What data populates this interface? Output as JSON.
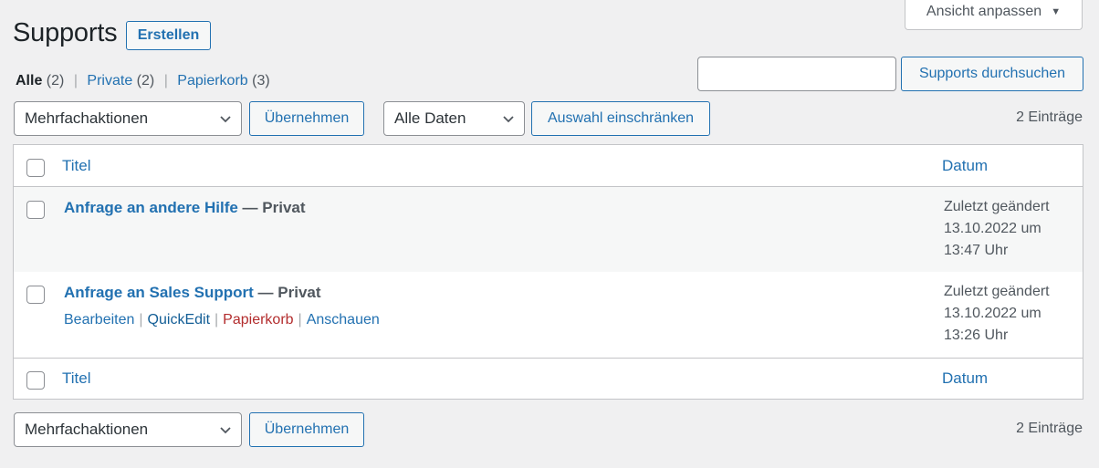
{
  "screen_options": {
    "label": "Ansicht anpassen",
    "arrow_icon": "triangle-down-icon"
  },
  "page": {
    "title": "Supports",
    "add_new_label": "Erstellen"
  },
  "views": [
    {
      "label": "Alle",
      "count": "(2)",
      "current": true
    },
    {
      "label": "Private",
      "count": "(2)",
      "current": false
    },
    {
      "label": "Papierkorb",
      "count": "(3)",
      "current": false
    }
  ],
  "views_sep": "|",
  "search": {
    "value": "",
    "placeholder": "",
    "button_label": "Supports durchsuchen"
  },
  "top_nav": {
    "bulk_action_selected": "Mehrfachaktionen",
    "apply_label": "Übernehmen",
    "date_filter_selected": "Alle Daten",
    "filter_label": "Auswahl einschränken",
    "items_count": "2 Einträge"
  },
  "table": {
    "columns": {
      "title": "Titel",
      "date": "Datum"
    },
    "rows": [
      {
        "title": "Anfrage an andere Hilfe",
        "state": " — Privat",
        "date_lines": [
          "Zuletzt geändert",
          "13.10.2022 um",
          "13:47 Uhr"
        ]
      },
      {
        "title": "Anfrage an Sales Support",
        "state": " — Privat",
        "date_lines": [
          "Zuletzt geändert",
          "13.10.2022 um",
          "13:26 Uhr"
        ],
        "actions": {
          "edit": "Bearbeiten",
          "quick_edit": "QuickEdit",
          "trash": "Papierkorb",
          "view": "Anschauen",
          "sep": "|"
        }
      }
    ]
  },
  "bottom_nav": {
    "bulk_action_selected": "Mehrfachaktionen",
    "apply_label": "Übernehmen",
    "items_count": "2 Einträge"
  },
  "colors": {
    "link": "#2271b1",
    "trash": "#b32d2e",
    "background": "#f0f0f1"
  }
}
